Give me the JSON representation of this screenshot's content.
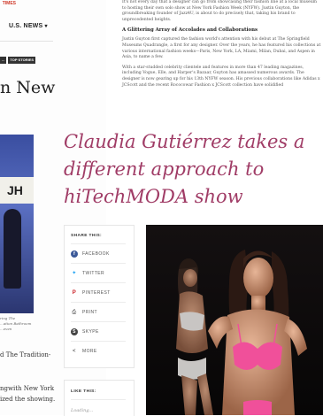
{
  "left_page": {
    "brand": "TIMES",
    "nav_label": "U.S. NEWS",
    "nav_chevron": "chevron-down-icon",
    "tags": [
      "...",
      "TOP STORIES"
    ],
    "headline_fragment": "n New",
    "photo_banner_text": "JH",
    "caption_lines": [
      "ring The",
      "...ation Bathroom",
      "...even"
    ],
    "text_fragment_1": "d The Tradition-",
    "text_fragment_2a": "ngwith New York",
    "text_fragment_2b": "ized the showing."
  },
  "article": {
    "paragraph_1": "It's not every day that a designer can go from showcasing their fashion line at a local museum to hosting their own solo show at New York Fashion Week (NYFW). Justin Guyton, the groundbreaking founder of Jazz4U, is about to do precisely that, taking his brand to unprecedented heights.",
    "subheading": "A Glittering Array of Accolades and Collaborations",
    "paragraph_2": "Justin Guyton first captured the fashion world's attention with his debut at The Springfield Museums Quadrangle, a first for any designer. Over the years, he has featured his collections at various international fashion weeks—Paris, New York, LA, Miami, Milan, Dubai, and Aspen in Asia, to name a few.",
    "paragraph_3": "With a star-studded celebrity clientele and features in more than 47 leading magazines, including Vogue, Elle, and Harper's Bazaar, Guyton has amassed numerous awards. The designer is now gearing up for his 13th NYFW season. His previous collaborations like Adidas x JCScott and the recent Rococowar Fashion x JCScott collection have solidified"
  },
  "headline": "Claudia Gutiérrez takes a different approach to hiTechMODA show",
  "share": {
    "title": "SHARE THIS:",
    "items": [
      {
        "label": "FACEBOOK",
        "icon": "facebook-icon",
        "glyph": "f",
        "color": "#3b5998"
      },
      {
        "label": "TWITTER",
        "icon": "twitter-icon",
        "glyph": "✦",
        "color": "#1da1f2"
      },
      {
        "label": "PINTEREST",
        "icon": "pinterest-icon",
        "glyph": "P",
        "color": "#cb2027"
      },
      {
        "label": "PRINT",
        "icon": "print-icon",
        "glyph": "⎙",
        "color": "#333333"
      },
      {
        "label": "SKYPE",
        "icon": "skype-icon",
        "glyph": "S",
        "color": "#444444"
      },
      {
        "label": "MORE",
        "icon": "share-more-icon",
        "glyph": "<",
        "color": "#333333"
      }
    ]
  },
  "like": {
    "title": "LIKE THIS:",
    "loading": "Loading..."
  },
  "colors": {
    "headline": "#a03c66",
    "swimsuit_pink": "#f0509a",
    "swimsuit_white": "#e9e6e4"
  }
}
